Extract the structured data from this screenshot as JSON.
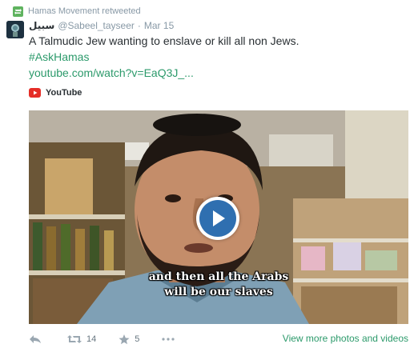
{
  "retweet": {
    "label": "Hamas Movement retweeted",
    "icon": "retweet-icon"
  },
  "tweet": {
    "name": "سبيل",
    "handle": "@Sabeel_tayseer",
    "separator": "·",
    "time": "Mar 15",
    "text": "A Talmudic Jew wanting to enslave or kill all non Jews.",
    "hashtag": "#AskHamas",
    "link": "youtube.com/watch?v=EaQ3J_..."
  },
  "card": {
    "source": "YouTube",
    "subtitle_line1": "and then all the Arabs",
    "subtitle_line2": "will be our slaves"
  },
  "actions": {
    "retweets": "14",
    "favorites": "5",
    "view_more": "View more photos and videos"
  },
  "colors": {
    "link": "#2c9a6b",
    "muted": "#8899a6",
    "youtube_red": "#e52d27",
    "play_blue": "#2f6fb0"
  }
}
